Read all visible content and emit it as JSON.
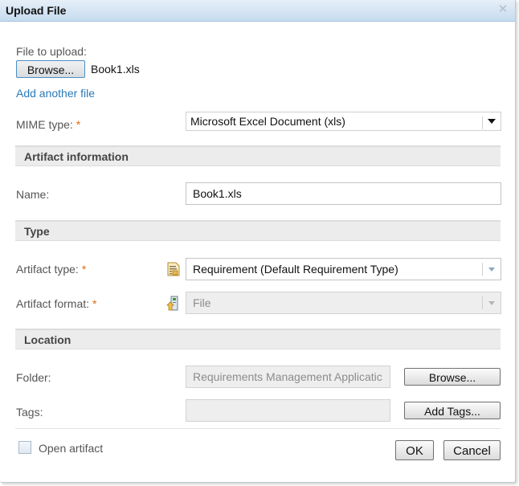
{
  "dialog": {
    "title": "Upload File",
    "close_icon": "close-x-icon"
  },
  "upload": {
    "file_label": "File to upload:",
    "browse_label": "Browse...",
    "file_name": "Book1.xls",
    "add_another_label": "Add another file",
    "mime_label": "MIME type:",
    "required_marker": "*",
    "mime_value": "Microsoft Excel Document (xls)"
  },
  "artifact_info": {
    "header": "Artifact information",
    "name_label": "Name:",
    "name_value": "Book1.xls"
  },
  "type": {
    "header": "Type",
    "artifact_type_label": "Artifact type:",
    "artifact_type_icon": "requirement-document-icon",
    "artifact_type_value": "Requirement (Default Requirement Type)",
    "artifact_format_label": "Artifact format:",
    "artifact_format_icon": "file-format-icon",
    "artifact_format_value": "File"
  },
  "location": {
    "header": "Location",
    "folder_label": "Folder:",
    "folder_value": "Requirements Management Applicatic",
    "browse_label": "Browse...",
    "tags_label": "Tags:",
    "tags_value": "",
    "add_tags_label": "Add Tags..."
  },
  "footer": {
    "open_artifact_label": "Open artifact",
    "open_artifact_checked": false,
    "ok_label": "OK",
    "cancel_label": "Cancel"
  },
  "colors": {
    "link": "#2a7ab8",
    "required": "#e06a12",
    "title_bar": "#c6dbef"
  }
}
